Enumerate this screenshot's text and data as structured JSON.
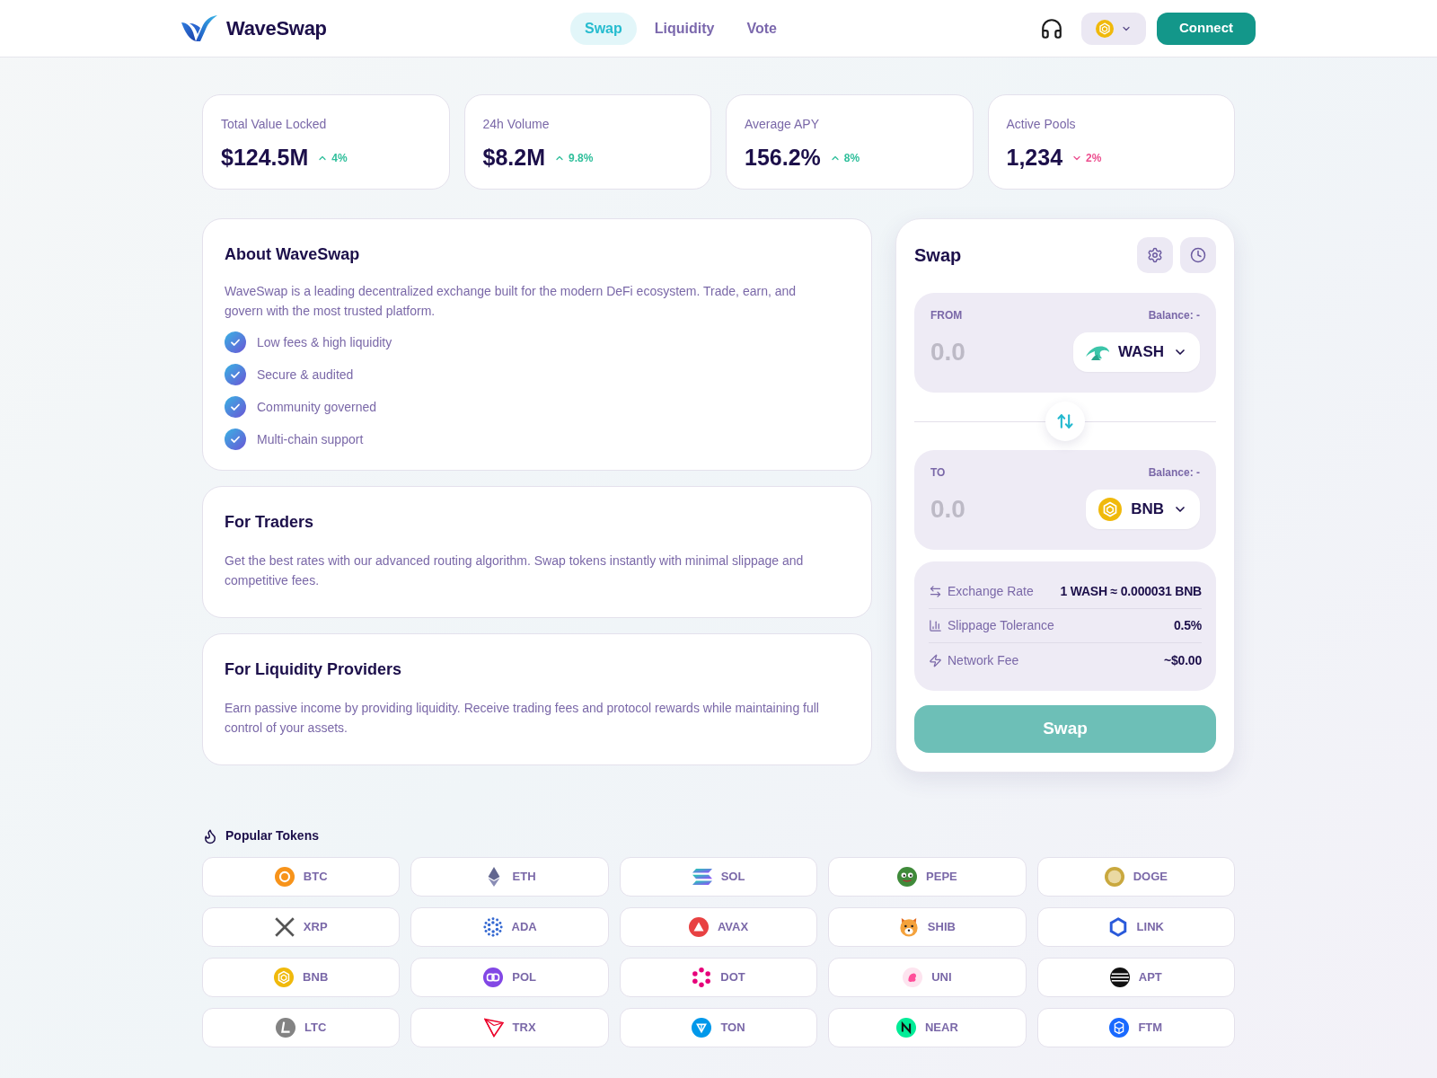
{
  "header": {
    "logo": "WaveSwap",
    "nav": [
      {
        "label": "Swap",
        "selected": true
      },
      {
        "label": "Liquidity",
        "selected": false
      },
      {
        "label": "Vote",
        "selected": false
      }
    ],
    "connect_button": "Connect"
  },
  "stats": [
    {
      "label": "Total Value Locked",
      "value": "$124.5M",
      "change": "4%",
      "rising": true
    },
    {
      "label": "24h Volume",
      "value": "$8.2M",
      "change": "9.8%",
      "rising": true
    },
    {
      "label": "Average APY",
      "value": "156.2%",
      "change": "8%",
      "rising": true
    },
    {
      "label": "Active Pools",
      "value": "1,234",
      "change": "2%",
      "rising": false
    }
  ],
  "about": {
    "title": "About WaveSwap",
    "description": "WaveSwap is a leading decentralized exchange built for the modern DeFi ecosystem. Trade, earn, and govern with the most trusted platform.",
    "features": [
      "Low fees & high liquidity",
      "Secure & audited",
      "Community governed",
      "Multi-chain support"
    ]
  },
  "info_cards": [
    {
      "title": "For Traders",
      "description": "Get the best rates with our advanced routing algorithm. Swap tokens instantly with minimal slippage and competitive fees."
    },
    {
      "title": "For Liquidity Providers",
      "description": "Earn passive income by providing liquidity. Receive trading fees and protocol rewards while maintaining full control of your assets."
    }
  ],
  "swap": {
    "title": "Swap",
    "from": {
      "label": "FROM",
      "balance": "Balance: -",
      "placeholder": "0.0",
      "token": "WASH"
    },
    "to": {
      "label": "TO",
      "balance": "Balance: -",
      "placeholder": "0.0",
      "token": "BNB"
    },
    "details": [
      {
        "kind": "rate",
        "label": "Exchange Rate",
        "value": "1 WASH ≈ 0.000031 BNB"
      },
      {
        "kind": "slippage",
        "label": "Slippage Tolerance",
        "value": "0.5%"
      },
      {
        "kind": "fee",
        "label": "Network Fee",
        "value": "~$0.00"
      }
    ],
    "button": "Swap"
  },
  "popular_tokens": {
    "title": "Popular Tokens",
    "tokens": [
      "BTC",
      "ETH",
      "SOL",
      "PEPE",
      "DOGE",
      "XRP",
      "ADA",
      "AVAX",
      "SHIB",
      "LINK",
      "BNB",
      "POL",
      "DOT",
      "UNI",
      "APT",
      "LTC",
      "TRX",
      "TON",
      "NEAR",
      "FTM"
    ]
  }
}
